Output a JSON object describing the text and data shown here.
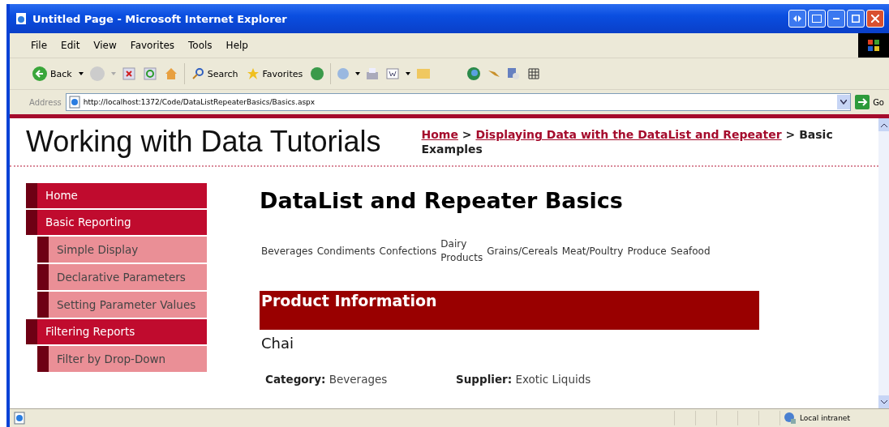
{
  "window": {
    "title": "Untitled Page - Microsoft Internet Explorer"
  },
  "menu": [
    "File",
    "Edit",
    "View",
    "Favorites",
    "Tools",
    "Help"
  ],
  "toolbar": {
    "back": "Back",
    "search": "Search",
    "favorites": "Favorites"
  },
  "address": {
    "label": "Address",
    "url": "http://localhost:1372/Code/DataListRepeaterBasics/Basics.aspx",
    "go": "Go"
  },
  "site_title": "Working with Data Tutorials",
  "breadcrumb": [
    {
      "kind": "link",
      "text": "Home"
    },
    {
      "kind": "separator",
      "text": ">"
    },
    {
      "kind": "link",
      "text": "Displaying Data with the DataList and Repeater"
    },
    {
      "kind": "separator",
      "text": ">"
    },
    {
      "kind": "current",
      "text": "Basic Examples"
    }
  ],
  "sidebar": {
    "items": [
      {
        "label": "Home"
      },
      {
        "label": "Basic Reporting",
        "children": [
          {
            "label": "Simple Display"
          },
          {
            "label": "Declarative Parameters"
          },
          {
            "label": "Setting Parameter Values"
          }
        ]
      },
      {
        "label": "Filtering Reports",
        "children": [
          {
            "label": "Filter by Drop-Down"
          }
        ]
      }
    ]
  },
  "heading": "DataList and Repeater Basics",
  "categories": [
    "Beverages",
    "Condiments",
    "Confections",
    "Dairy Products",
    "Grains/Cereals",
    "Meat/Poultry",
    "Produce",
    "Seafood"
  ],
  "product": {
    "section_title": "Product Information",
    "name": "Chai",
    "fields": [
      {
        "label": "Category:",
        "value": "Beverages"
      },
      {
        "label": "Supplier:",
        "value": "Exotic Liquids"
      }
    ]
  },
  "status_bar": {
    "zone": "Local intranet"
  }
}
